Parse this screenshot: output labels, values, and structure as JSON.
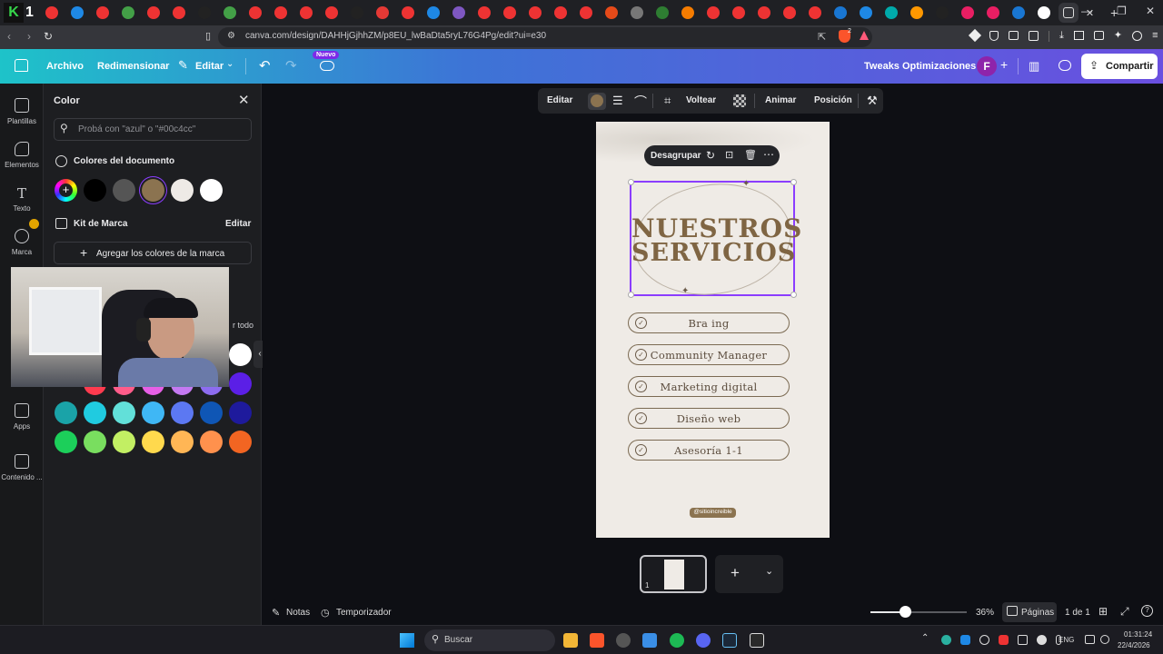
{
  "browser": {
    "url": "canva.com/design/DAHHjGjhhZM/p8EU_lwBaDta5ryL76G4Pg/edit?ui=e30",
    "tab_colors": [
      "#e33",
      "#1e88e5",
      "#e33",
      "#43a047",
      "#e33",
      "#e33",
      "#222",
      "#43a047",
      "#e33",
      "#e33",
      "#e33",
      "#e33",
      "#222",
      "#e53935",
      "#e33",
      "#1e88e5",
      "#7e57c2",
      "#e33",
      "#e33",
      "#e33",
      "#e33",
      "#e33",
      "#e64a19",
      "#777",
      "#2e7d32",
      "#f57c00",
      "#e33",
      "#e33",
      "#e33",
      "#e33",
      "#e33",
      "#1976d2",
      "#1e88e5",
      "#0aa",
      "#ff9800",
      "#222",
      "#e91e63",
      "#e91e63",
      "#1976d2",
      "#fff"
    ],
    "brave_badge": "2"
  },
  "header": {
    "archivo": "Archivo",
    "redimensionar": "Redimensionar",
    "editar": "Editar",
    "nuevo_badge": "Nuevo",
    "project_name": "Tweaks Optimizaciones",
    "avatar_letter": "F",
    "share": "Compartir"
  },
  "rail": {
    "plantillas": "Plantillas",
    "elementos": "Elementos",
    "texto": "Texto",
    "marca": "Marca",
    "apps": "Apps",
    "contenido": "Contenido ..."
  },
  "panel": {
    "title": "Color",
    "search_placeholder": "Probá con \"azul\" o \"#00c4cc\"",
    "doc_colors_title": "Colores del documento",
    "doc_colors": [
      "#000000",
      "#555555",
      "#8b7350",
      "#eeeae6",
      "#ffffff"
    ],
    "brand_kit_title": "Kit de Marca",
    "brand_kit_edit": "Editar",
    "add_brand_colors": "Agregar los colores de la marca",
    "see_all_fragment": "r todo",
    "palette_rows": [
      [
        "#ff3b4f",
        "#ff5c8a",
        "#e65fe6",
        "#c479f2",
        "#8d6cf0",
        "#5b1fe6"
      ],
      [
        "#1aa3a8",
        "#20cbe0",
        "#62e0d9",
        "#3fb7f5",
        "#5c78f2",
        "#0f56b5",
        "#1e1a9c"
      ],
      [
        "#1ccf5a",
        "#79de5f",
        "#c2ef63",
        "#ffd94d",
        "#ffb655",
        "#ff914d",
        "#f26522"
      ]
    ]
  },
  "toolbar": {
    "editar": "Editar",
    "color": "#8b7350",
    "voltear": "Voltear",
    "animar": "Animar",
    "posicion": "Posición"
  },
  "design": {
    "context_ungroup": "Desagrupar",
    "title_line1": "NUESTROS",
    "title_line2": "SERVICIOS",
    "services": [
      "Bra  ing",
      "Community Manager",
      "Marketing digital",
      "Diseño web",
      "Asesoría 1-1"
    ],
    "handle": "@sitioincreible"
  },
  "bottom": {
    "notas": "Notas",
    "temporizador": "Temporizador",
    "zoom_percent": "36%",
    "zoom_level": 0.36,
    "paginas": "Páginas",
    "page_count": "1 de 1",
    "thumb_number": "1"
  },
  "taskbar": {
    "search": "Buscar",
    "lang": "ENG",
    "time": "01:31:24",
    "date": "22/4/2026"
  }
}
